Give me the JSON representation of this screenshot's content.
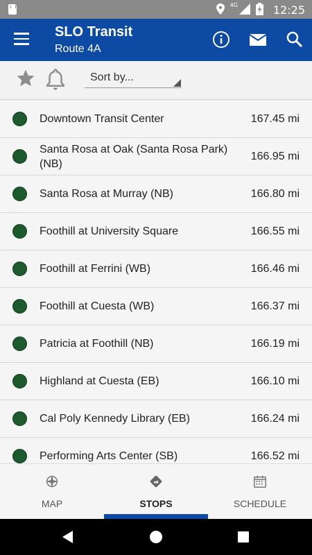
{
  "status_bar": {
    "time": "12:25",
    "network": "4G",
    "icons": [
      "sd-card-icon",
      "location-icon",
      "signal-icon",
      "battery-charging-icon"
    ]
  },
  "app_bar": {
    "title": "SLO Transit",
    "subtitle": "Route 4A",
    "actions": [
      "info-icon",
      "mail-icon",
      "search-icon"
    ],
    "color": "#0d4aa3"
  },
  "toolbar": {
    "sort_label": "Sort by..."
  },
  "stops": [
    {
      "name": "Downtown Transit Center",
      "distance": "167.45 mi"
    },
    {
      "name": "Santa Rosa at Oak (Santa Rosa Park) (NB)",
      "distance": "166.95 mi"
    },
    {
      "name": "Santa Rosa at Murray (NB)",
      "distance": "166.80 mi"
    },
    {
      "name": "Foothill at University Square",
      "distance": "166.55 mi"
    },
    {
      "name": "Foothill at Ferrini (WB)",
      "distance": "166.46 mi"
    },
    {
      "name": "Foothill at Cuesta (WB)",
      "distance": "166.37 mi"
    },
    {
      "name": "Patricia at Foothill (NB)",
      "distance": "166.19 mi"
    },
    {
      "name": "Highland at Cuesta (EB)",
      "distance": "166.10 mi"
    },
    {
      "name": "Cal Poly Kennedy Library (EB)",
      "distance": "166.24 mi"
    },
    {
      "name": "Performing Arts Center (SB)",
      "distance": "166.52 mi"
    }
  ],
  "stop_dot_color": "#1d5a2e",
  "tabs": [
    {
      "label": "MAP",
      "icon": "compass-icon",
      "active": false
    },
    {
      "label": "STOPS",
      "icon": "directions-icon",
      "active": true
    },
    {
      "label": "SCHEDULE",
      "icon": "calendar-icon",
      "active": false
    }
  ]
}
